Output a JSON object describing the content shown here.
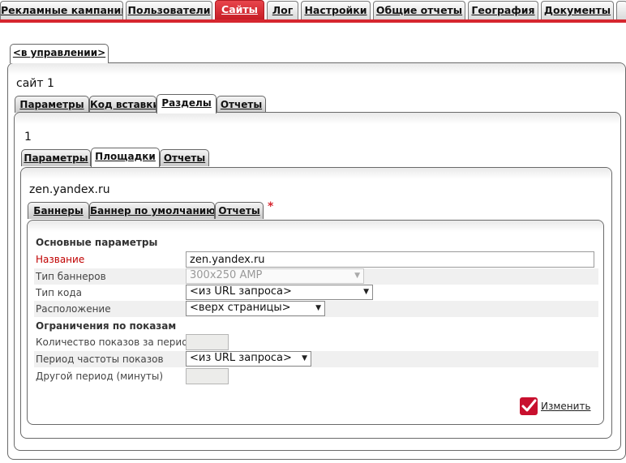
{
  "topnav": {
    "tabs": [
      {
        "label": "Рекламные кампании"
      },
      {
        "label": "Пользователи"
      },
      {
        "label": "Сайты"
      },
      {
        "label": "Лог"
      },
      {
        "label": "Настройки"
      },
      {
        "label": "Общие отчеты"
      },
      {
        "label": "География"
      },
      {
        "label": "Документы"
      }
    ],
    "active_tab": "Сайты",
    "accent_color": "#d6262f"
  },
  "back_tab": {
    "label": "<в управлении>"
  },
  "site": {
    "title": "сайт 1",
    "tabs": [
      {
        "label": "Параметры"
      },
      {
        "label": "Код вставки"
      },
      {
        "label": "Разделы"
      },
      {
        "label": "Отчеты"
      }
    ],
    "active_tab": "Разделы"
  },
  "section": {
    "title": "1",
    "tabs": [
      {
        "label": "Параметры"
      },
      {
        "label": "Площадки"
      },
      {
        "label": "Отчеты"
      }
    ],
    "active_tab": "Площадки"
  },
  "place": {
    "title": "zen.yandex.ru",
    "tabs": [
      {
        "label": "Баннеры"
      },
      {
        "label": "Баннер по умолчанию"
      },
      {
        "label": "Отчеты"
      }
    ],
    "marker": "*"
  },
  "form": {
    "section_main": "Основные параметры",
    "name_label": "Название",
    "name_value": "zen.yandex.ru",
    "banner_type_label": "Тип баннеров",
    "banner_type_value": "300x250 AMP",
    "code_type_label": "Тип кода",
    "code_type_value": "<из URL запроса>",
    "location_label": "Расположение",
    "location_value": "<верх страницы>",
    "section_limits": "Ограничения по показам",
    "count_label": "Количество показов за период",
    "count_value": "",
    "period_label": "Период частоты показов",
    "period_value": "<из URL запроса>",
    "other_period_label": "Другой период (минуты)",
    "other_period_value": ""
  },
  "action": {
    "edit_label": "Изменить",
    "icon": "check-icon",
    "icon_color": "#c8102e"
  }
}
